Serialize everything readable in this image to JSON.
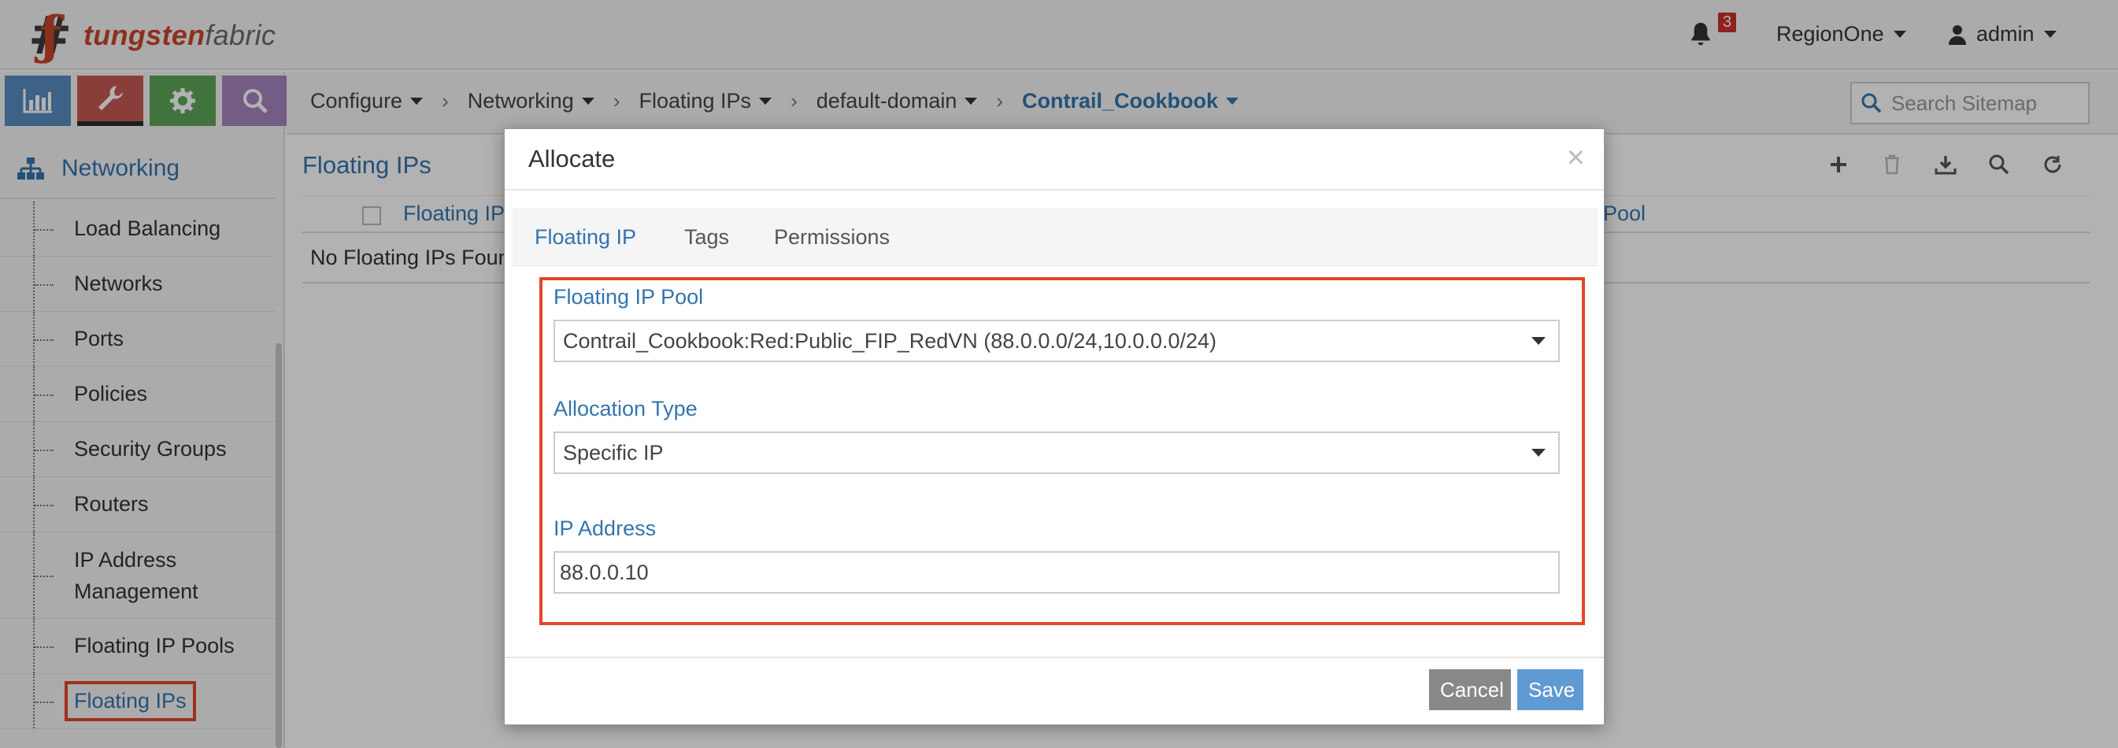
{
  "header": {
    "logo_part1": "tungsten",
    "logo_part2": "fabric",
    "notification_count": "3",
    "region": "RegionOne",
    "user": "admin"
  },
  "sidebar": {
    "section_title": "Networking",
    "items": [
      {
        "label": "Load Balancing"
      },
      {
        "label": "Networks"
      },
      {
        "label": "Ports"
      },
      {
        "label": "Policies"
      },
      {
        "label": "Security Groups"
      },
      {
        "label": "Routers"
      },
      {
        "label_line1": "IP Address",
        "label_line2": "Management"
      },
      {
        "label": "Floating IP Pools"
      },
      {
        "label": "Floating IPs"
      }
    ]
  },
  "breadcrumb": [
    "Configure",
    "Networking",
    "Floating IPs",
    "default-domain",
    "Contrail_Cookbook"
  ],
  "search": {
    "placeholder": "Search Sitemap"
  },
  "main": {
    "title": "Floating IPs",
    "columns": [
      "Floating IP",
      "Pool"
    ],
    "empty_message": "No Floating IPs Foun"
  },
  "modal": {
    "title": "Allocate",
    "close": "×",
    "tabs": [
      "Floating IP",
      "Tags",
      "Permissions"
    ],
    "fields": {
      "pool_label": "Floating IP Pool",
      "pool_value": "Contrail_Cookbook:Red:Public_FIP_RedVN (88.0.0.0/24,10.0.0.0/24)",
      "alloc_label": "Allocation Type",
      "alloc_value": "Specific IP",
      "ip_label": "IP Address",
      "ip_value": "88.0.0.10"
    },
    "buttons": {
      "cancel": "Cancel",
      "save": "Save"
    }
  },
  "colors": {
    "accent": "#3474ad",
    "highlight": "#e2472a",
    "brand_red": "#c9462c"
  }
}
